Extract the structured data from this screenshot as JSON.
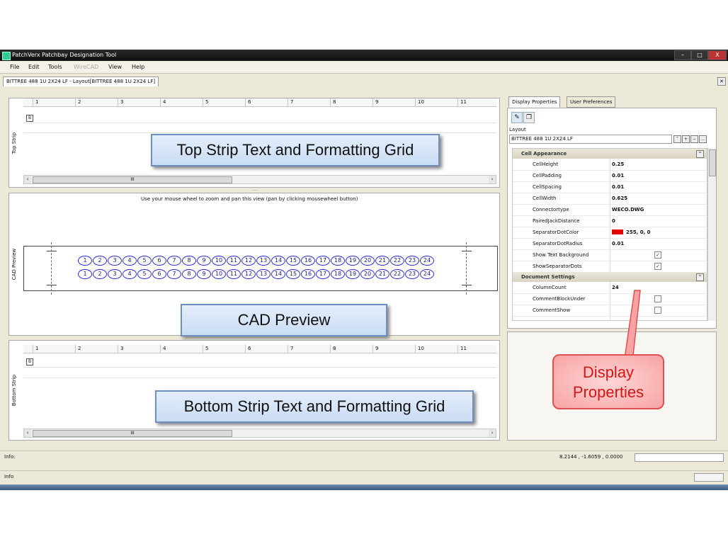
{
  "window": {
    "title": "PatchVerx Patchbay Designation Tool",
    "controls": [
      "–",
      "□",
      "X"
    ]
  },
  "menu": [
    "File",
    "Edit",
    "Tools",
    "WireCAD",
    "View",
    "Help"
  ],
  "doc_tab": "BITTREE 488 1U 2X24 LF - Layout[BITTREE 488 1U 2X24 LF]",
  "top_strip": {
    "label": "Top Strip",
    "columns": [
      "1",
      "2",
      "3",
      "4",
      "5",
      "6",
      "7",
      "8",
      "9",
      "10",
      "11"
    ],
    "row_marker": "B",
    "callout": "Top Strip Text and Formatting Grid",
    "scroll_mark": "III"
  },
  "cad_preview": {
    "label": "CAD Preview",
    "hint": "Use your mouse wheel to zoom and pan this view (pan by clicking mousewheel button)",
    "jacks": [
      "1",
      "2",
      "3",
      "4",
      "5",
      "6",
      "7",
      "8",
      "9",
      "10",
      "11",
      "12",
      "13",
      "14",
      "15",
      "16",
      "17",
      "18",
      "19",
      "20",
      "21",
      "22",
      "23",
      "24"
    ],
    "callout": "CAD Preview"
  },
  "bottom_strip": {
    "label": "Bottom Strip",
    "columns": [
      "1",
      "2",
      "3",
      "4",
      "5",
      "6",
      "7",
      "8",
      "9",
      "10",
      "11"
    ],
    "row_marker": "B",
    "callout": "Bottom Strip Text and Formatting Grid",
    "scroll_mark": "III"
  },
  "properties": {
    "tabs": [
      "Display Properties",
      "User Preferences"
    ],
    "layout_label": "Layout",
    "layout_value": "BITTREE 488 1U 2X24 LF",
    "sections": [
      {
        "title": "Cell Appearance",
        "rows": [
          {
            "name": "CellHeight",
            "value": "0.25"
          },
          {
            "name": "CellPadding",
            "value": "0.01"
          },
          {
            "name": "CellSpacing",
            "value": "0.01"
          },
          {
            "name": "CellWidth",
            "value": "0.625"
          },
          {
            "name": "Connectortype",
            "value": "WECO.DWG"
          },
          {
            "name": "PairedJackDistance",
            "value": "0"
          },
          {
            "name": "SeparatorDotColor",
            "value": "255, 0, 0"
          },
          {
            "name": "SeparatorDotRadius",
            "value": "0.01"
          },
          {
            "name": "Show Text Background",
            "value": ""
          },
          {
            "name": "ShowSeparatorDots",
            "value": ""
          }
        ]
      },
      {
        "title": "Document Settings",
        "rows": [
          {
            "name": "ColumnCount",
            "value": "24"
          },
          {
            "name": "CommentBlockUnder",
            "value": ""
          },
          {
            "name": "CommentShow",
            "value": ""
          }
        ]
      }
    ],
    "separator_color": "#e00000",
    "callout": [
      "Display",
      "Properties"
    ]
  },
  "status": {
    "info_label": "Info:",
    "coords": "8.2144 , -1.6059 , 0.0000"
  },
  "bottom_info": "Info"
}
